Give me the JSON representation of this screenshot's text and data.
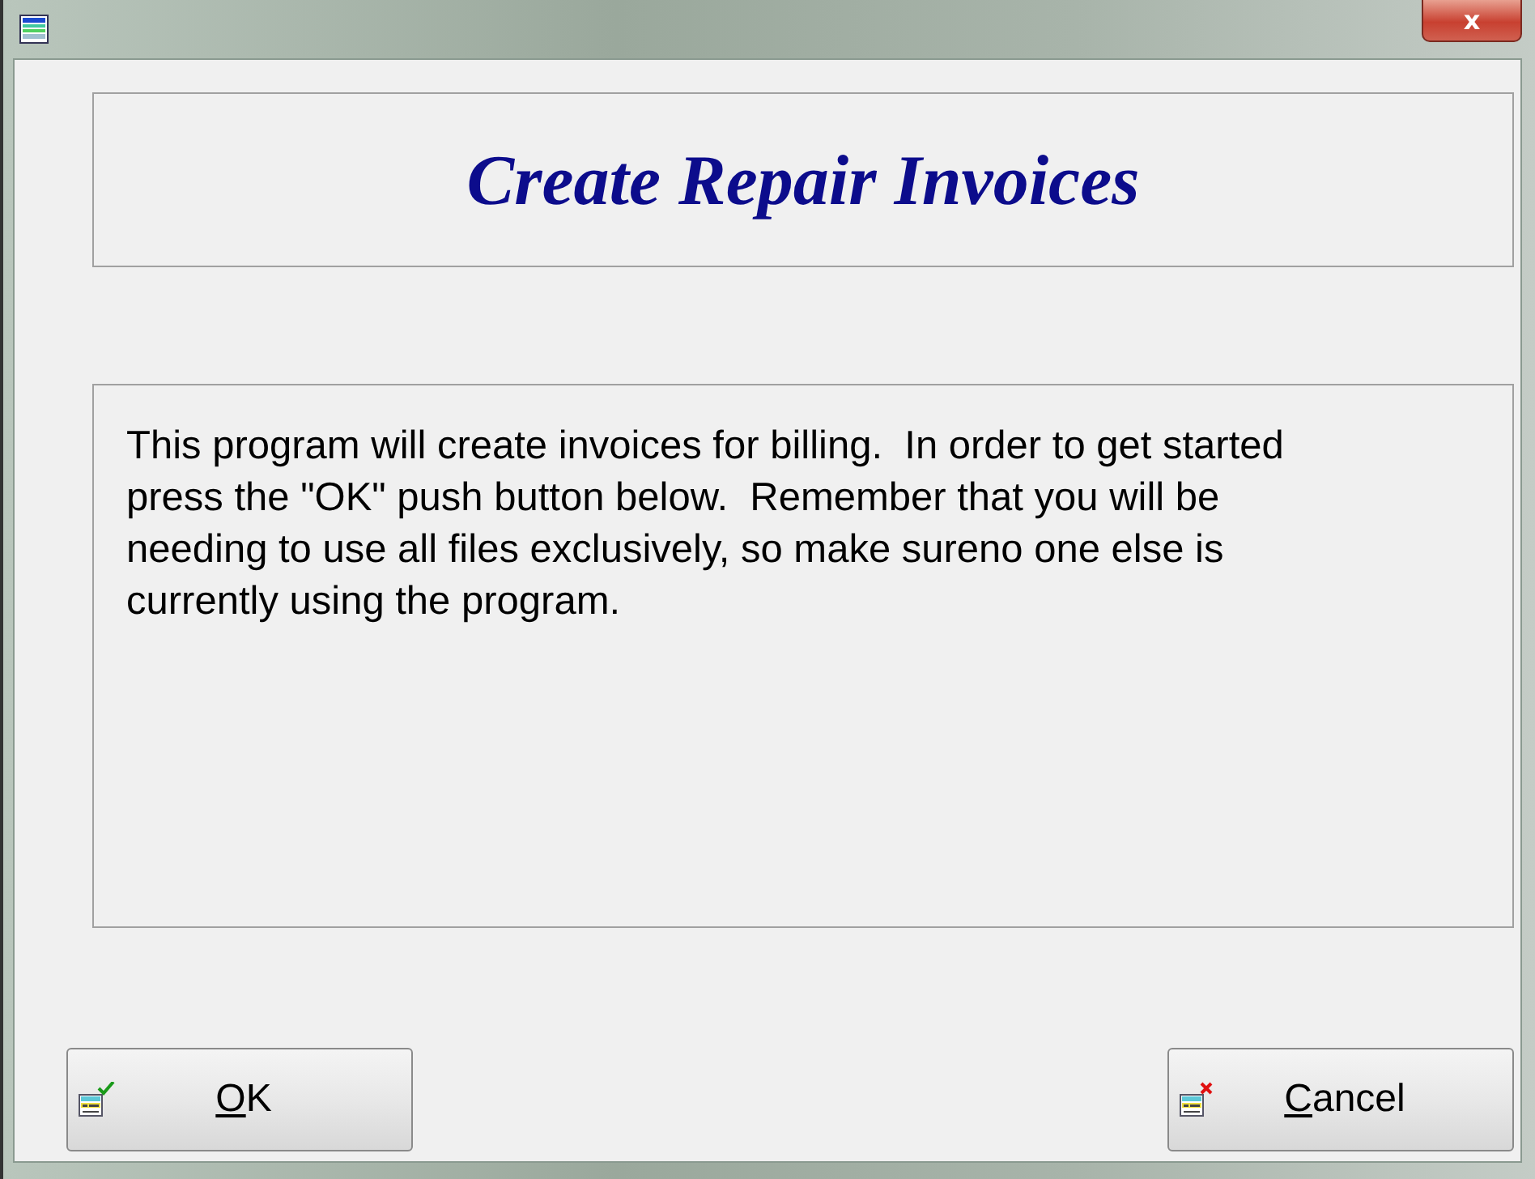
{
  "window": {
    "close_glyph": "x"
  },
  "header": {
    "title": "Create Repair Invoices"
  },
  "message": {
    "text": "This program will create invoices for billing.  In order to get started press the \"OK\" push button below.  Remember that you will be needing to use all files exclusively, so make sureno one else is currently using the program."
  },
  "buttons": [
    {
      "kind": "confirm",
      "label_parts": [
        {
          "text": "O",
          "underline": true
        },
        {
          "text": "K",
          "underline": false
        }
      ]
    },
    {
      "kind": "cancel",
      "label_parts": [
        {
          "text": "C",
          "underline": true
        },
        {
          "text": "ancel",
          "underline": false
        }
      ]
    }
  ]
}
